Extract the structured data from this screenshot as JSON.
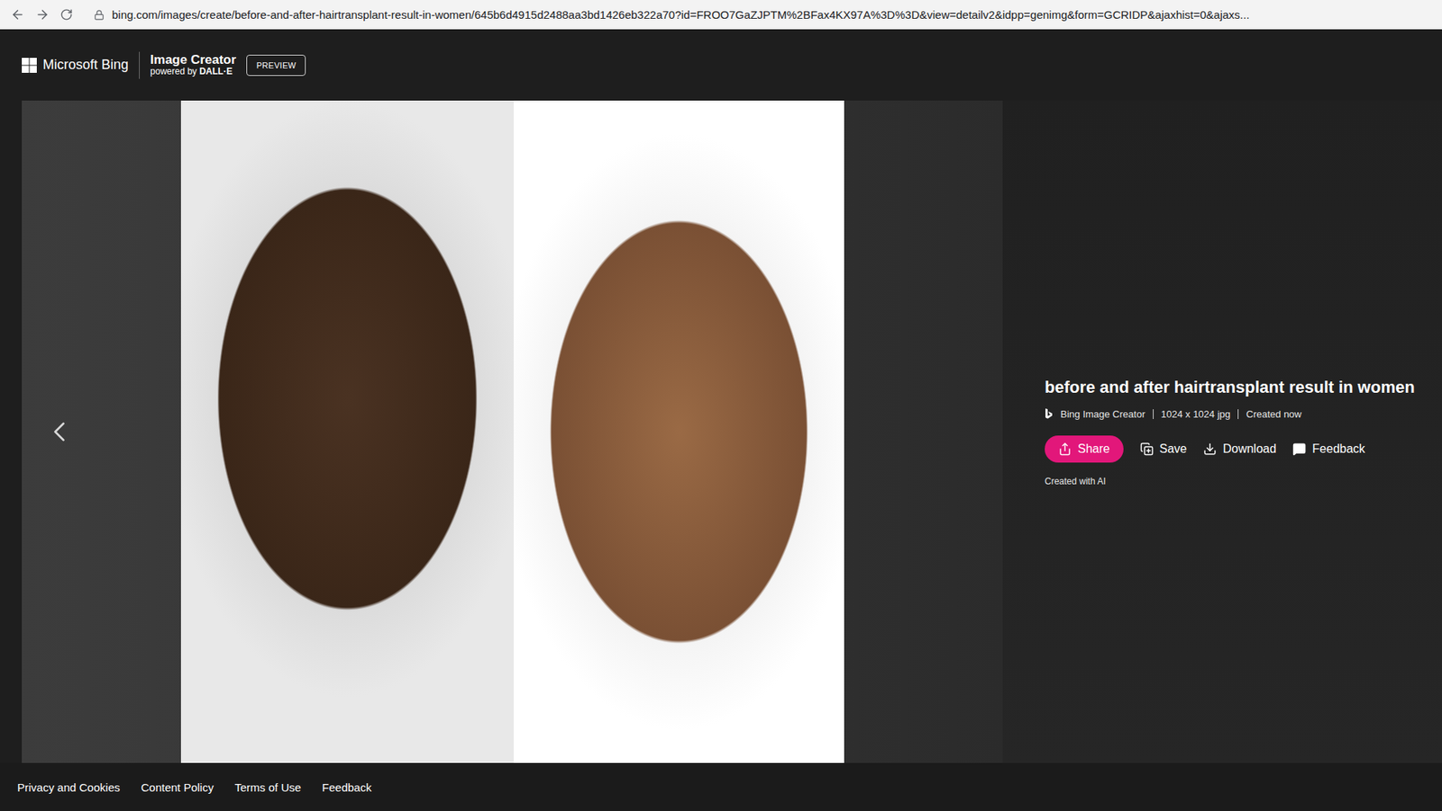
{
  "browser": {
    "url": "bing.com/images/create/before-and-after-hairtransplant-result-in-women/645b6d4915d2488aa3bd1426eb322a70?id=FROO7GaZJPTM%2BFax4KX97A%3D%3D&view=detailv2&idpp=genimg&form=GCRIDP&ajaxhist=0&ajaxs..."
  },
  "header": {
    "brand": "Microsoft Bing",
    "product": "Image Creator",
    "powered_prefix": "powered by",
    "powered_name": "DALL·E",
    "badge": "PREVIEW"
  },
  "details": {
    "title": "before and after hairtransplant result in women",
    "meta": [
      "Bing Image Creator",
      "1024 x 1024 jpg",
      "Created now"
    ],
    "buttons": [
      {
        "label": "Share",
        "primary": true
      },
      {
        "label": "Save",
        "primary": false
      },
      {
        "label": "Download",
        "primary": false
      },
      {
        "label": "Feedback",
        "primary": false
      }
    ],
    "note": "Created with AI"
  },
  "footer": {
    "links": [
      "Privacy and Cookies",
      "Content Policy",
      "Terms of Use",
      "Feedback"
    ]
  }
}
